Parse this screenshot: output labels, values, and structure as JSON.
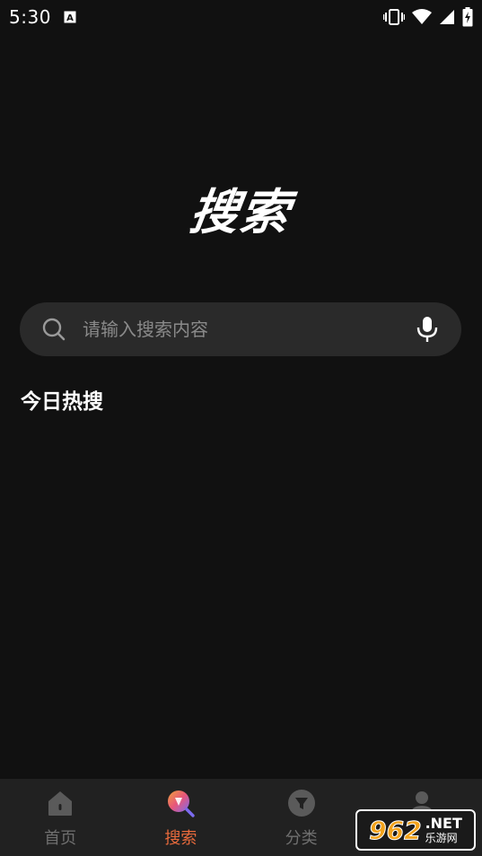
{
  "status_bar": {
    "time": "5:30",
    "icons": [
      "notification-a-icon",
      "vibrate-icon",
      "wifi-icon",
      "signal-icon",
      "battery-charging-icon"
    ]
  },
  "hero": {
    "title": "搜索"
  },
  "search": {
    "placeholder": "请输入搜索内容",
    "value": ""
  },
  "section": {
    "title": "今日热搜"
  },
  "tabs": [
    {
      "label": "首页",
      "icon": "home-icon",
      "active": false
    },
    {
      "label": "搜索",
      "icon": "search-tab-icon",
      "active": true
    },
    {
      "label": "分类",
      "icon": "filter-icon",
      "active": false
    },
    {
      "label": "",
      "icon": "profile-icon",
      "active": false
    }
  ],
  "watermark": {
    "number": "962",
    "net": ".NET",
    "cn": "乐游网"
  },
  "colors": {
    "background": "#111111",
    "accent": "#e86a3c",
    "tab_bar": "#212121",
    "search_bg": "#2a2a2a"
  }
}
